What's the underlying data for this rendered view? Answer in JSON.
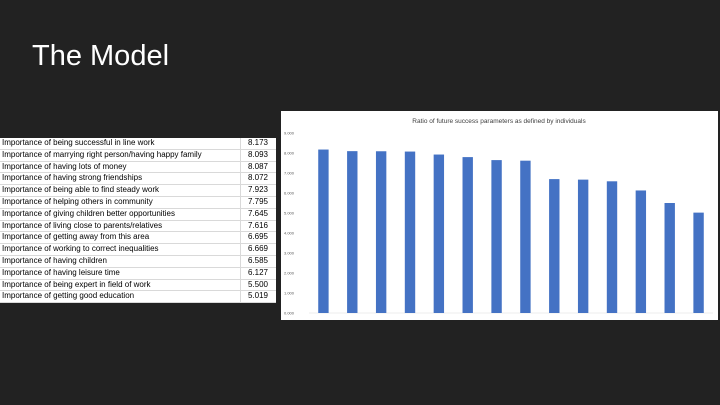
{
  "slide": {
    "title": "The Model"
  },
  "table": {
    "rows": [
      {
        "label": "Importance of being successful in line work",
        "value": "8.173"
      },
      {
        "label": "Importance of marrying right person/having happy family",
        "value": "8.093"
      },
      {
        "label": "Importance of having lots of money",
        "value": "8.087"
      },
      {
        "label": "Importance of having strong friendships",
        "value": "8.072"
      },
      {
        "label": "Importance of being able to find steady work",
        "value": "7.923"
      },
      {
        "label": "Importance of helping others in community",
        "value": "7.795"
      },
      {
        "label": "Importance of giving children better opportunities",
        "value": "7.645"
      },
      {
        "label": "Importance of living close to parents/relatives",
        "value": "7.616"
      },
      {
        "label": "Importance of getting away from this area",
        "value": "6.695"
      },
      {
        "label": "Importance of working to correct inequalities",
        "value": "6.669"
      },
      {
        "label": "Importance of having children",
        "value": "6.585"
      },
      {
        "label": "Importance of having leisure time",
        "value": "6.127"
      },
      {
        "label": "Importance of being expert in field of work",
        "value": "5.500"
      },
      {
        "label": "Importance of getting good education",
        "value": "5.019"
      }
    ]
  },
  "chart_data": {
    "type": "bar",
    "title": "Ratio of future success parameters as defined by individuals",
    "xlabel": "",
    "ylabel": "",
    "ylim": [
      0,
      9
    ],
    "yticks": [
      "0.000",
      "1.000",
      "2.000",
      "3.000",
      "4.000",
      "5.000",
      "6.000",
      "7.000",
      "8.000",
      "9.000"
    ],
    "values": [
      8.173,
      8.093,
      8.087,
      8.072,
      7.923,
      7.795,
      7.645,
      7.616,
      6.695,
      6.669,
      6.585,
      6.127,
      5.5,
      5.019
    ],
    "bar_color": "#4472c4",
    "grid": false,
    "legend": "none"
  }
}
